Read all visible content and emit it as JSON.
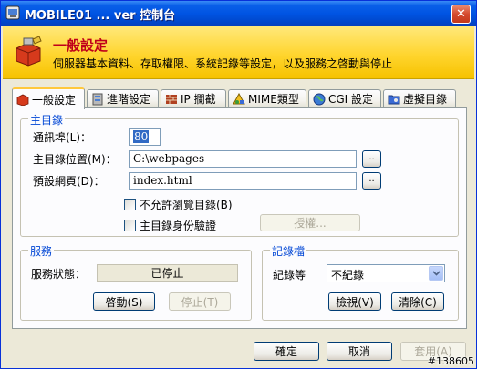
{
  "window": {
    "title": "MOBILE01 ... ver 控制台",
    "close_label": "✕"
  },
  "header": {
    "title": "一般設定",
    "description": "伺服器基本資料、存取權限、系統記錄等設定，以及服務之啓動與停止"
  },
  "tabs": [
    {
      "label": "一般設定",
      "icon": "toolbox-icon"
    },
    {
      "label": "進階設定",
      "icon": "server-icon"
    },
    {
      "label": "IP 攔截",
      "icon": "firewall-icon"
    },
    {
      "label": "MIME類型",
      "icon": "mime-icon"
    },
    {
      "label": "CGI 設定",
      "icon": "globe-icon"
    },
    {
      "label": "虛擬目錄",
      "icon": "folder-icon"
    }
  ],
  "main_dir": {
    "group_label": "主目錄",
    "port_label": "通訊埠(L)：",
    "port_value": "80",
    "path_label": "主目錄位置(M)：",
    "path_value": "C:\\webpages",
    "default_page_label": "預設網頁(D)：",
    "default_page_value": "index.html",
    "browse_label": "..",
    "no_browse_label": "不允許瀏覽目錄(B)",
    "auth_label": "主目錄身份驗證",
    "authorize_button": "授權..."
  },
  "service": {
    "group_label": "服務",
    "status_label": "服務狀態：",
    "status_value": "已停止",
    "start_button": "啓動(S)",
    "stop_button": "停止(T)"
  },
  "logging": {
    "group_label": "記錄檔",
    "level_label": "紀錄等",
    "level_value": "不紀錄",
    "view_button": "檢視(V)",
    "clear_button": "清除(C)"
  },
  "footer": {
    "ok_button": "確定",
    "cancel_button": "取消",
    "apply_button": "套用(A)"
  },
  "watermark": "#138605"
}
